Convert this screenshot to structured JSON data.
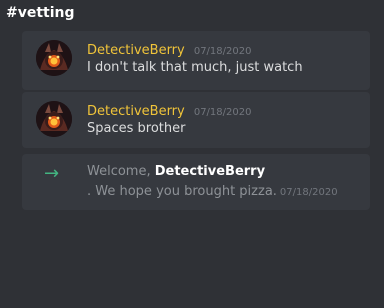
{
  "channel": {
    "name": "#vetting"
  },
  "messages": [
    {
      "username": "DetectiveBerry",
      "timestamp": "07/18/2020",
      "content": "I don't talk that much, just watch",
      "avatar_icon": "fiery-character-avatar"
    },
    {
      "username": "DetectiveBerry",
      "timestamp": "07/18/2020",
      "content": "Spaces brother",
      "avatar_icon": "fiery-character-avatar"
    }
  ],
  "join": {
    "icon": "green-arrow-right-icon",
    "prefix": "Welcome, ",
    "username": "DetectiveBerry",
    "suffix": ". We hope you brought pizza.",
    "timestamp": "07/18/2020"
  },
  "colors": {
    "background": "#2f3136",
    "card": "#36393f",
    "username": "#f0c43a",
    "join_arrow": "#43b581"
  }
}
